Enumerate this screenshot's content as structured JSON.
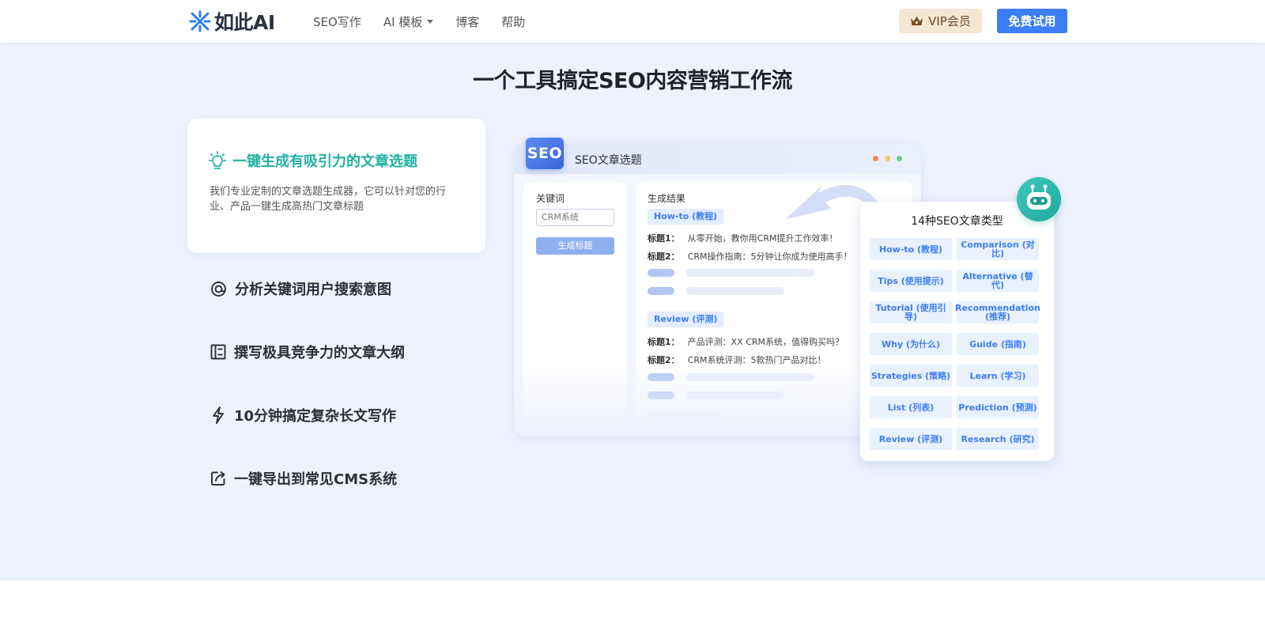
{
  "header": {
    "logo_text": "如此AI",
    "nav": [
      {
        "label": "SEO写作"
      },
      {
        "label": "AI 模板",
        "has_dropdown": true
      },
      {
        "label": "博客"
      },
      {
        "label": "帮助"
      }
    ],
    "vip_label": "VIP会员",
    "trial_label": "免费试用"
  },
  "section": {
    "title": "一个工具搞定SEO内容营销工作流",
    "active_feature": {
      "icon": "lightbulb-icon",
      "title": "一键生成有吸引力的文章选题",
      "description": "我们专业定制的文章选题生成器，它可以针对您的行业、产品一键生成高热门文章标题"
    },
    "features": [
      {
        "icon": "target-icon",
        "label": "分析关键词用户搜索意图"
      },
      {
        "icon": "outline-icon",
        "label": "撰写极具竞争力的文章大纲"
      },
      {
        "icon": "lightning-icon",
        "label": "10分钟搞定复杂长文写作"
      },
      {
        "icon": "export-icon",
        "label": "一键导出到常见CMS系统"
      }
    ]
  },
  "mockup": {
    "badge": "SEO",
    "title": "SEO文章选题",
    "keyword_label": "关键词",
    "keyword_value": "CRM系统",
    "generate_label": "生成标题",
    "results_label": "生成结果",
    "groups": [
      {
        "tag": "How-to (教程)",
        "lines": [
          {
            "key": "标题1：",
            "text": "从零开始，教你用CRM提升工作效率！"
          },
          {
            "key": "标题2：",
            "text": "CRM操作指南：5分钟让你成为使用高手！"
          }
        ]
      },
      {
        "tag": "Review (评测)",
        "lines": [
          {
            "key": "标题1：",
            "text": "产品评测：XX CRM系统，值得购买吗？"
          },
          {
            "key": "标题2：",
            "text": "CRM系统评测：5款热门产品对比！"
          }
        ]
      }
    ]
  },
  "types_panel": {
    "title": "14种SEO文章类型",
    "types": [
      "How-to (教程)",
      "Comparison (对比)",
      "Tips (使用提示)",
      "Alternative (替代)",
      "Tutorial (使用引导)",
      "Recommendation (推荐)",
      "Why (为什么)",
      "Guide (指南)",
      "Strategies (策略)",
      "Learn (学习)",
      "List (列表)",
      "Prediction (预测)",
      "Review (评测)",
      "Research (研究)"
    ]
  },
  "colors": {
    "accent": "#3c7ef5",
    "teal": "#20b2a4",
    "vip_bg": "#f6e6d4",
    "section_bg": "#eef2fc"
  }
}
